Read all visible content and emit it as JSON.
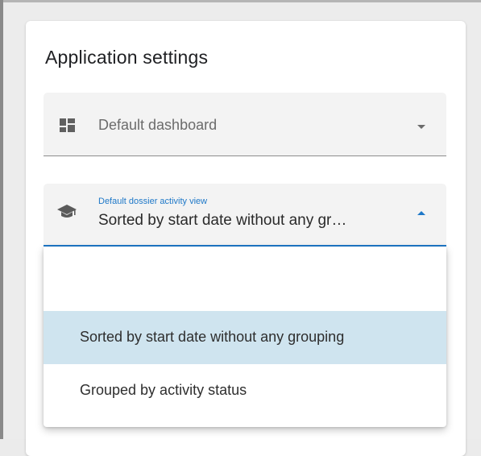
{
  "card": {
    "title": "Application settings"
  },
  "default_dashboard": {
    "label": "Default dashboard",
    "icon": "dashboard-icon",
    "expanded": false
  },
  "activity_view": {
    "floating_label": "Default dossier activity view",
    "value": "Sorted by start date without any gr…",
    "icon": "graduation-cap-icon",
    "expanded": true
  },
  "menu": {
    "options": [
      {
        "label": ""
      },
      {
        "label": "Sorted by start date without any grouping",
        "selected": true
      },
      {
        "label": "Grouped by activity status",
        "selected": false
      }
    ]
  },
  "colors": {
    "accent": "#1e78c8",
    "selected_bg": "#cfe4ef",
    "field_bg": "#f3f3f3"
  }
}
